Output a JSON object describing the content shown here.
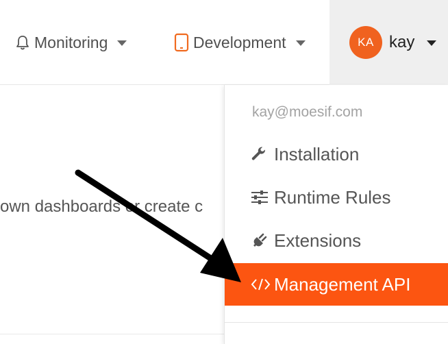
{
  "nav": {
    "monitoring": {
      "label": "Monitoring",
      "icon": "bell-icon"
    },
    "development": {
      "label": "Development",
      "icon": "tablet-icon"
    }
  },
  "user": {
    "initials": "KA",
    "name": "kay",
    "email": "kay@moesif.com"
  },
  "content": {
    "text": "own dashboards or create c"
  },
  "menu": {
    "items": [
      {
        "label": "Installation",
        "icon": "wrench-icon"
      },
      {
        "label": "Runtime Rules",
        "icon": "sliders-icon"
      },
      {
        "label": "Extensions",
        "icon": "plug-icon"
      },
      {
        "label": "Management API",
        "icon": "code-icon",
        "highlighted": true
      }
    ]
  },
  "colors": {
    "accent": "#fc5511",
    "avatar": "#f0621f",
    "development_icon": "#f06a1f"
  }
}
